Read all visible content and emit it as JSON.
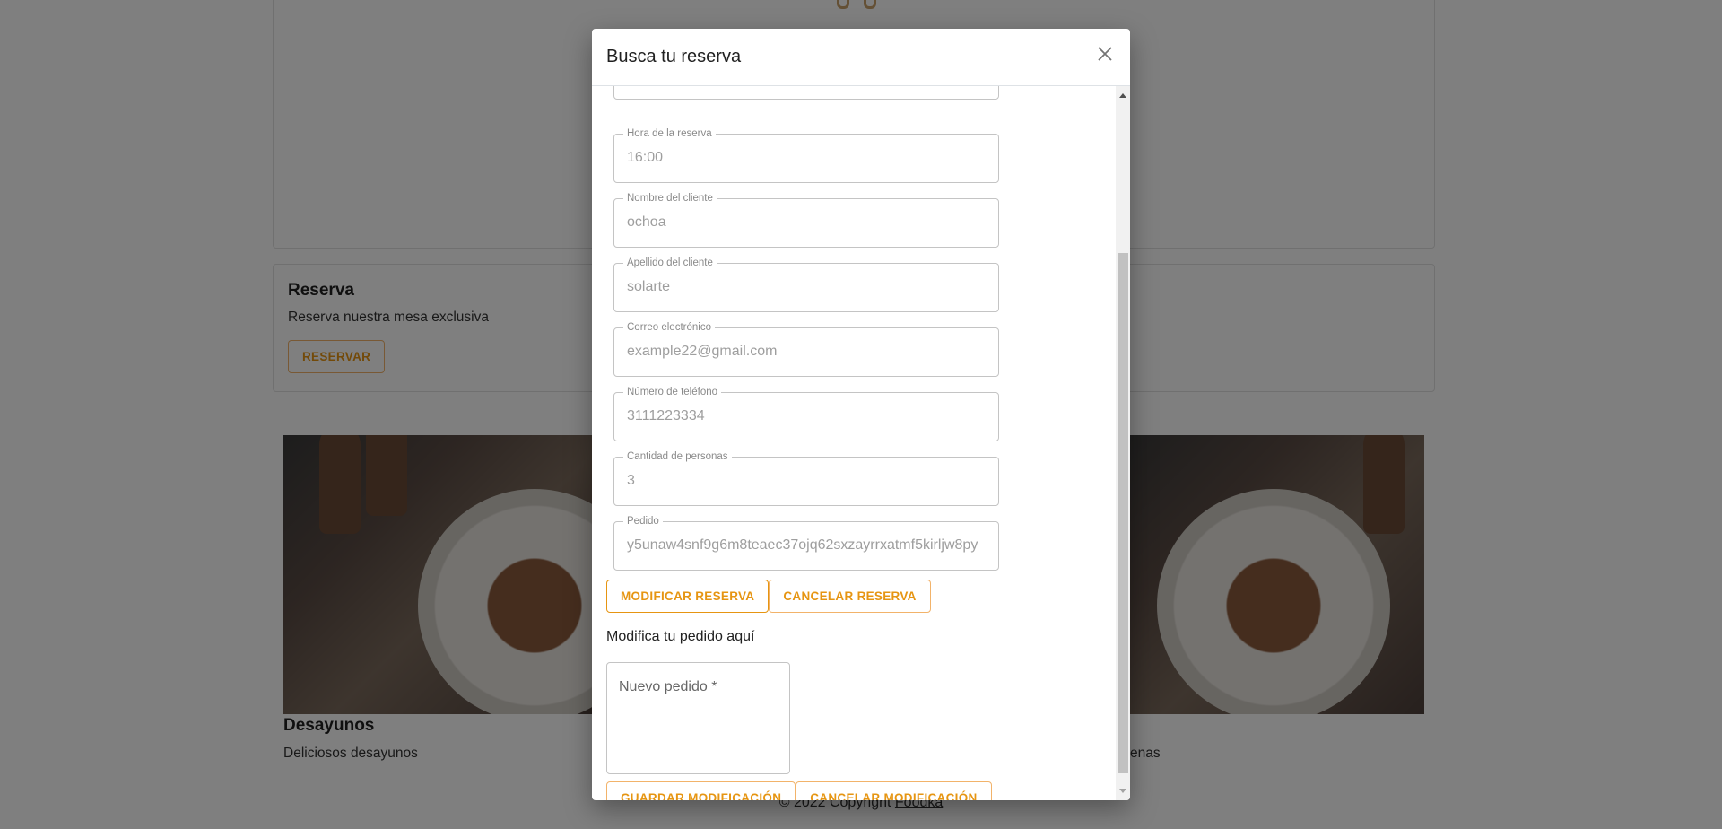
{
  "background": {
    "reserva_card": {
      "title": "Reserva",
      "description": "Reserva nuestra mesa exclusiva",
      "button": "RESERVAR"
    },
    "food_cards": [
      {
        "title": "Desayunos",
        "description": "Deliciosos desayunos"
      },
      {
        "title": "",
        "description": "enas"
      }
    ],
    "footer": {
      "text": "© 2022 Copyright ",
      "link": "Foodka"
    }
  },
  "modal": {
    "title": "Busca tu reserva",
    "fields": [
      {
        "label": "Hora de la reserva",
        "value": "16:00"
      },
      {
        "label": "Nombre del cliente",
        "value": "ochoa"
      },
      {
        "label": "Apellido del cliente",
        "value": "solarte"
      },
      {
        "label": "Correo electrónico",
        "value": "example22@gmail.com"
      },
      {
        "label": "Número de teléfono",
        "value": "3111223334"
      },
      {
        "label": "Cantidad de personas",
        "value": "3"
      },
      {
        "label": "Pedido",
        "value": "y5unaw4snf9g6m8teaec37ojq62sxzayrrxatmf5kirljw8py"
      }
    ],
    "buttons": {
      "modify": "MODIFICAR RESERVA",
      "cancel": "CANCELAR RESERVA",
      "save_mod": "GUARDAR MODIFICACIÓN",
      "cancel_mod": "CANCELAR MODIFICACIÓN"
    },
    "modify_text": "Modifica tu pedido aquí",
    "new_order_placeholder": "Nuevo pedido *"
  },
  "colors": {
    "accent": "#e69512",
    "accent_border": "#f2b36a"
  }
}
